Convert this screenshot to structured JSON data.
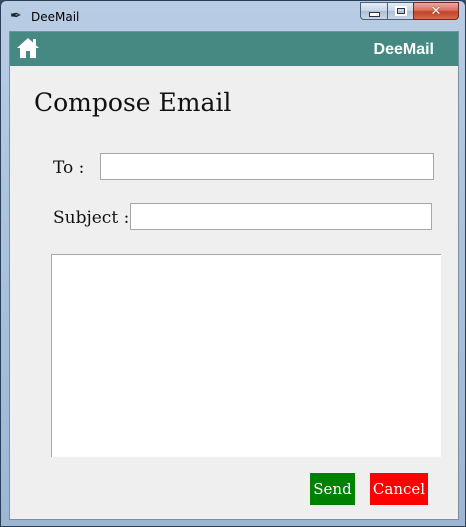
{
  "window": {
    "title": "DeeMail",
    "icon": "feather-icon",
    "controls": [
      "minimize-icon",
      "maximize-icon",
      "close-icon"
    ]
  },
  "appbar": {
    "brand": "DeeMail",
    "home_icon": "home-icon",
    "color": "#468882"
  },
  "compose": {
    "heading": "Compose Email",
    "to_label": "To :",
    "to_value": "",
    "subject_label": "Subject :",
    "subject_value": "",
    "body_value": ""
  },
  "actions": {
    "send_label": "Send",
    "send_color": "#008000",
    "cancel_label": "Cancel",
    "cancel_color": "#ff0000"
  }
}
